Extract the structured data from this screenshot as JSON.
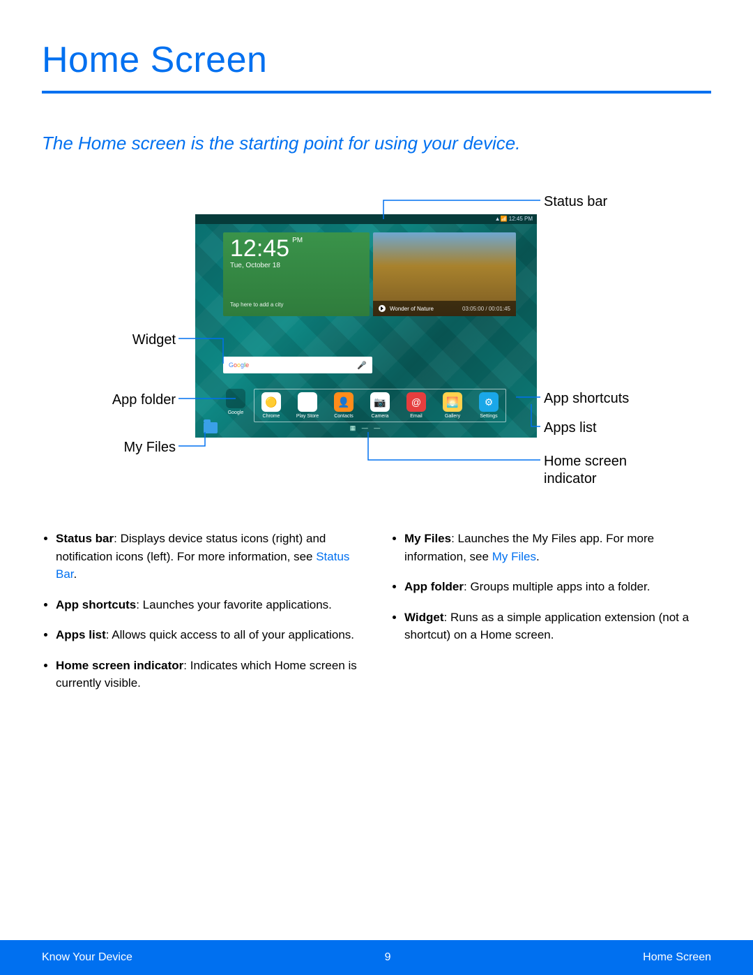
{
  "title": "Home Screen",
  "subtitle": "The Home screen is the starting point for using your device.",
  "callouts": {
    "status_bar": "Status bar",
    "widget": "Widget",
    "app_folder": "App folder",
    "my_files": "My Files",
    "app_shortcuts": "App shortcuts",
    "apps_list": "Apps list",
    "home_indicator": "Home screen indicator"
  },
  "tablet": {
    "status_time": "▲📶 12:45 PM",
    "clock": {
      "time": "12:45",
      "ampm": "PM",
      "date": "Tue, October 18",
      "tap_hint": "Tap here to add a city"
    },
    "photo": {
      "title": "Wonder of Nature",
      "counter": "03:05:00 / 00:01:45"
    },
    "search": {
      "brand": "Google",
      "mic": "🎤"
    },
    "folder_label": "Google",
    "apps": [
      {
        "label": "Chrome"
      },
      {
        "label": "Play Store"
      },
      {
        "label": "Contacts"
      },
      {
        "label": "Camera"
      },
      {
        "label": "Email"
      },
      {
        "label": "Gallery"
      },
      {
        "label": "Settings"
      }
    ],
    "indicator": "▦ — —"
  },
  "bullets_left": [
    {
      "bold": "Status bar",
      "text": ": Displays device status icons (right) and notification icons (left). For more information, see ",
      "link": "Status Bar",
      "tail": "."
    },
    {
      "bold": "App shortcuts",
      "text": ": Launches your favorite applications."
    },
    {
      "bold": "Apps list",
      "text": ": Allows quick access to all of your applications."
    },
    {
      "bold": "Home screen indicator",
      "text": ": Indicates which Home screen is currently visible."
    }
  ],
  "bullets_right": [
    {
      "bold": "My Files",
      "text": ": Launches the My Files app. For more information, see ",
      "link": "My Files",
      "tail": "."
    },
    {
      "bold": "App folder",
      "text": ": Groups multiple apps into a folder."
    },
    {
      "bold": "Widget",
      "text": ": Runs as a simple application extension (not a shortcut) on a Home screen."
    }
  ],
  "footer": {
    "left": "Know Your Device",
    "center": "9",
    "right": "Home Screen"
  }
}
